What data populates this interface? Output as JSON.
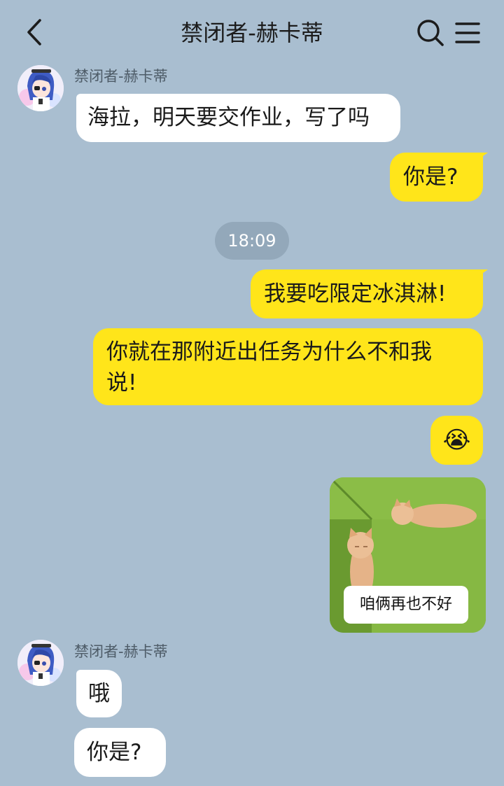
{
  "header": {
    "title": "禁闭者-赫卡蒂",
    "back_icon": "chevron-left-icon",
    "search_icon": "search-icon",
    "menu_icon": "menu-icon"
  },
  "colors": {
    "background": "#a9bed0",
    "outgoing_bubble": "#ffe51a",
    "incoming_bubble": "#ffffff",
    "time_pill": "#93a8ba"
  },
  "messages": {
    "m1": {
      "sender": "禁闭者-赫卡蒂",
      "text": "海拉，明天要交作业，写了吗"
    },
    "m2": {
      "text": "你是?"
    },
    "time": "18:09",
    "m3": {
      "text": "我要吃限定冰淇淋!"
    },
    "m4": {
      "text": "你就在那附近出任务为什么不和我说!"
    },
    "m5": {
      "emoji": "😭"
    },
    "m6": {
      "sticker_caption": "咱俩再也不好"
    },
    "m7": {
      "sender": "禁闭者-赫卡蒂",
      "text": "哦"
    },
    "m8": {
      "text": "你是?"
    }
  }
}
